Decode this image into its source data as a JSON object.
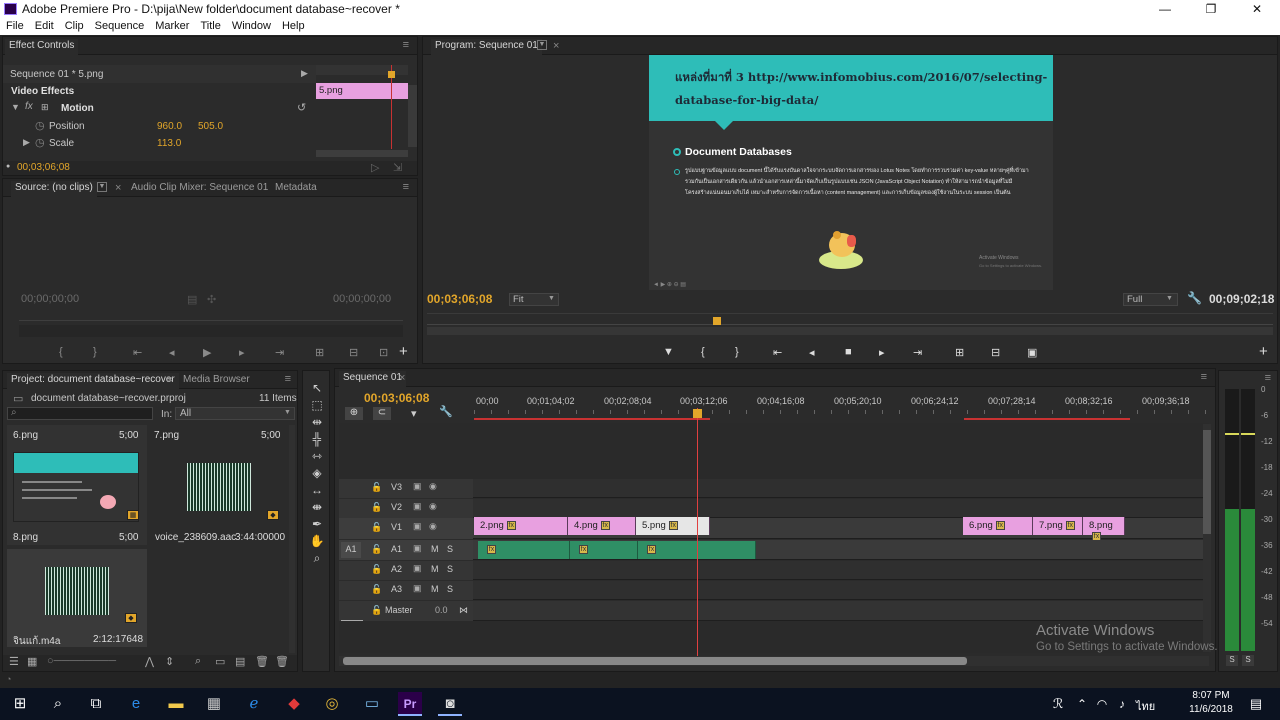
{
  "window": {
    "title": "Adobe Premiere Pro - D:\\pija\\New folder\\document database~recover *",
    "min": "—",
    "max": "❐",
    "close": "✕"
  },
  "menu": [
    "File",
    "Edit",
    "Clip",
    "Sequence",
    "Marker",
    "Title",
    "Window",
    "Help"
  ],
  "effect_controls": {
    "tab": "Effect Controls",
    "sequence_label": "Sequence 01 * 5.png",
    "clip_label": "5.png",
    "video_effects": "Video Effects",
    "motion": "Motion",
    "position_label": "Position",
    "position_x": "960.0",
    "position_y": "505.0",
    "scale_label": "Scale",
    "scale_value": "113.0",
    "timecode": "00;03;06;08"
  },
  "source": {
    "tabs": [
      "Source: (no clips)",
      "Audio Clip Mixer: Sequence 01",
      "Metadata"
    ],
    "tc_left": "00;00;00;00",
    "tc_right": "00;00;00;00"
  },
  "program": {
    "tab": "Program: Sequence 01",
    "timecode": "00;03;06;08",
    "fit": "Fit",
    "quality": "Full",
    "duration": "00;09;02;18",
    "slide_title_line1": "แหล่งที่มาที่ 3 http://www.infomobius.com/2016/07/selecting-",
    "slide_title_line2": "database-for-big-data/",
    "slide_heading": "Document Databases",
    "slide_body": "รูปแบบฐานข้อมูลแบบ document นี้ได้รับแรงบันดาลใจจากระบบจัดการเอกสารของ Lotus Notes โดยทำการรวบรวมค่า key-value หลายๆคู่ที่เข้ามารวมกันเป็นเอกสารเดียวกัน แล้วนำเอกสารเหล่านี้มาจัดเก็บเป็นรูปแบบเช่น JSON (JavaScript Object Notation) ทำให้สามารถนำข้อมูลที่ไม่มีโครงสร้างแน่นอนมาเก็บได้ เหมาะสำหรับการจัดการเนื้อหา (content management) และการเก็บข้อมูลของผู้ใช้งานในระบบ session เป็นต้น",
    "watermark_line1": "Activate Windows",
    "watermark_line2": "Go to Settings to activate Windows."
  },
  "project": {
    "tabs": [
      "Project: document database~recover",
      "Media Browser"
    ],
    "filename": "document database~recover.prproj",
    "count": "11 Items",
    "in_label": "In:",
    "in_value": "All",
    "items": [
      {
        "name": "6.png",
        "dur": "5;00"
      },
      {
        "name": "7.png",
        "dur": "5;00"
      },
      {
        "name": "8.png",
        "dur": "5;00"
      },
      {
        "name": "voice_238609.aac",
        "dur": "3:44:00000"
      },
      {
        "name": "จินแก้.m4a",
        "dur": "2:12:17648"
      }
    ]
  },
  "timeline": {
    "tab": "Sequence 01",
    "timecode": "00;03;06;08",
    "ticks": [
      "00;00",
      "00;01;04;02",
      "00;02;08;04",
      "00;03;12;06",
      "00;04;16;08",
      "00;05;20;10",
      "00;06;24;12",
      "00;07;28;14",
      "00;08;32;16",
      "00;09;36;18"
    ],
    "video_tracks": [
      "V3",
      "V2",
      "V1"
    ],
    "audio_tracks": [
      "A1",
      "A2",
      "A3"
    ],
    "master": "Master",
    "master_val": "0.0",
    "source_patch": "A1",
    "m": "M",
    "s": "S",
    "clips_v1": [
      "2.png",
      "4.png",
      "5.png",
      "6.png",
      "7.png",
      "8.png"
    ],
    "meter_scale": [
      "0",
      "-6",
      "-12",
      "-18",
      "-24",
      "-30",
      "-36",
      "-42",
      "-48",
      "-54"
    ],
    "meter_s": "S"
  },
  "taskbar": {
    "time": "8:07 PM",
    "date": "11/6/2018",
    "lang": "ไทย"
  }
}
